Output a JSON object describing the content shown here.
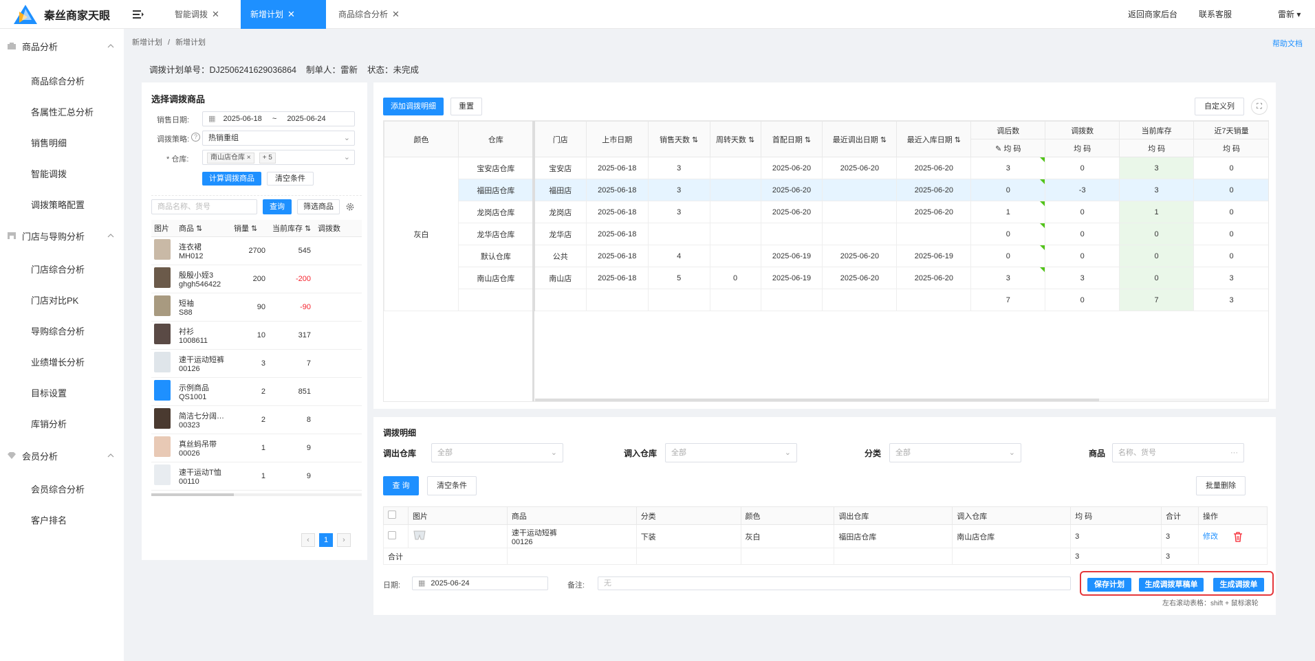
{
  "app": {
    "name": "秦丝商家天眼",
    "brand_color": "#1e90ff"
  },
  "tabs": [
    {
      "label": "智能调拨"
    },
    {
      "label": "新增计划"
    },
    {
      "label": "商品综合分析"
    }
  ],
  "header_links": {
    "back": "返回商家后台",
    "service": "联系客服",
    "user": "雷新 ▾"
  },
  "sidebar": {
    "groups": [
      {
        "label": "商品分析",
        "items": [
          "商品综合分析",
          "各属性汇总分析",
          "销售明细",
          "智能调拨",
          "调拨策略配置"
        ]
      },
      {
        "label": "门店与导购分析",
        "items": [
          "门店综合分析",
          "门店对比PK",
          "导购综合分析",
          "业绩增长分析",
          "目标设置",
          "库销分析"
        ]
      },
      {
        "label": "会员分析",
        "items": [
          "会员综合分析",
          "客户排名"
        ]
      }
    ]
  },
  "breadcrumb": [
    "新增计划",
    "/",
    "新增计划"
  ],
  "help": "帮助文档",
  "plan": {
    "no_label": "调拨计划单号：DJ2506241629036864",
    "maker": "制单人：雷新",
    "status": "状态：未完成"
  },
  "select_panel": {
    "title": "选择调拨商品",
    "date_label": "销售日期:",
    "date_from": "2025-06-18",
    "date_sep": "~",
    "date_to": "2025-06-24",
    "strategy_label": "调拨策略:",
    "strategy_value": "热销重组",
    "warehouse_label": "* 仓库:",
    "warehouse_tag": "南山店仓库 ×",
    "warehouse_more": "+ 5",
    "calc_btn": "计算调拨商品",
    "clear_btn": "清空条件",
    "search_placeholder": "商品名称、货号",
    "query_btn": "查询",
    "filter_btn": "筛选商品",
    "columns": [
      "图片",
      "商品 ⇅",
      "销量 ⇅",
      "当前库存 ⇅",
      "调拨数"
    ],
    "rows": [
      {
        "name": "连衣裙",
        "code": "MH012",
        "sales": "2700",
        "stock": "545",
        "neg": false,
        "color": "#c9b9a6"
      },
      {
        "name": "殷殷小姪3",
        "code": "ghgh546422",
        "sales": "200",
        "stock": "-200",
        "neg": true,
        "color": "#6b5a4a"
      },
      {
        "name": "短袖",
        "code": "S88",
        "sales": "90",
        "stock": "-90",
        "neg": true,
        "color": "#a89a80"
      },
      {
        "name": "衬衫",
        "code": "1008611",
        "sales": "10",
        "stock": "317",
        "neg": false,
        "color": "#5a4a45"
      },
      {
        "name": "速干运动短裤",
        "code": "00126",
        "sales": "3",
        "stock": "7",
        "neg": false,
        "color": "#dfe5ea"
      },
      {
        "name": "示例商品",
        "code": "QS1001",
        "sales": "2",
        "stock": "851",
        "neg": false,
        "color": "#1e90ff"
      },
      {
        "name": "简洁七分阔…",
        "code": "00323",
        "sales": "2",
        "stock": "8",
        "neg": false,
        "color": "#4a3a30"
      },
      {
        "name": "真丝蚂吊带",
        "code": "00026",
        "sales": "1",
        "stock": "9",
        "neg": false,
        "color": "#e8c9b5"
      },
      {
        "name": "速干运动T恤",
        "code": "00110",
        "sales": "1",
        "stock": "9",
        "neg": false,
        "color": "#e8ecf0"
      }
    ],
    "page": "1"
  },
  "grid_panel": {
    "add_btn": "添加调拨明细",
    "reset_btn": "重置",
    "custom_btn": "自定义列",
    "headers": [
      "颜色",
      "仓库",
      "门店",
      "上市日期",
      "销售天数 ⇅",
      "周转天数 ⇅",
      "首配日期 ⇅",
      "最近调出日期 ⇅",
      "最近入库日期 ⇅",
      "调后数",
      "调拨数",
      "当前库存",
      "近7天销量"
    ],
    "subheaders": [
      "✎ 均 码",
      "均 码",
      "均 码",
      "均 码"
    ],
    "color_value": "灰白",
    "rows": [
      [
        "宝安店仓库",
        "宝安店",
        "2025-06-18",
        "3",
        "",
        "2025-06-20",
        "2025-06-20",
        "2025-06-20",
        "3",
        "0",
        "3",
        "0"
      ],
      [
        "福田店仓库",
        "福田店",
        "2025-06-18",
        "3",
        "",
        "2025-06-20",
        "",
        "2025-06-20",
        "0",
        "-3",
        "3",
        "0"
      ],
      [
        "龙岗店仓库",
        "龙岗店",
        "2025-06-18",
        "3",
        "",
        "2025-06-20",
        "",
        "2025-06-20",
        "1",
        "0",
        "1",
        "0"
      ],
      [
        "龙华店仓库",
        "龙华店",
        "2025-06-18",
        "",
        "",
        "",
        "",
        "",
        "0",
        "0",
        "0",
        "0"
      ],
      [
        "默认仓库",
        "公共",
        "2025-06-18",
        "4",
        "",
        "2025-06-19",
        "2025-06-20",
        "2025-06-19",
        "0",
        "0",
        "0",
        "0"
      ],
      [
        "南山店仓库",
        "南山店",
        "2025-06-18",
        "5",
        "0",
        "2025-06-19",
        "2025-06-20",
        "2025-06-20",
        "3",
        "3",
        "0",
        "3"
      ]
    ],
    "totals": [
      "7",
      "0",
      "7",
      "3"
    ]
  },
  "detail_panel": {
    "title": "调拨明细",
    "out_label": "调出仓库",
    "out_value": "全部",
    "in_label": "调入仓库",
    "in_value": "全部",
    "cat_label": "分类",
    "cat_value": "全部",
    "goods_label": "商品",
    "goods_placeholder": "名称、货号",
    "query_btn": "查 询",
    "clear_btn": "清空条件",
    "batch_delete_btn": "批量删除",
    "columns": [
      "图片",
      "商品",
      "分类",
      "颜色",
      "调出仓库",
      "调入仓库",
      "均 码",
      "合计",
      "操作"
    ],
    "row": {
      "name": "速干运动短裤",
      "code": "00126",
      "category": "下装",
      "color": "灰白",
      "from": "福田店仓库",
      "to": "南山店仓库",
      "size": "3",
      "total": "3",
      "edit": "修改"
    },
    "sum_label": "合计",
    "sum_size": "3",
    "sum_total": "3",
    "date_label": "日期:",
    "date_value": "2025-06-24",
    "note_label": "备注:",
    "note_placeholder": "无",
    "save_btn": "保存计划",
    "draft_btn": "生成调拨草稿单",
    "gen_btn": "生成调拨单",
    "scroll_hint": "左右滚动表格：shift + 鼠标滚轮"
  }
}
